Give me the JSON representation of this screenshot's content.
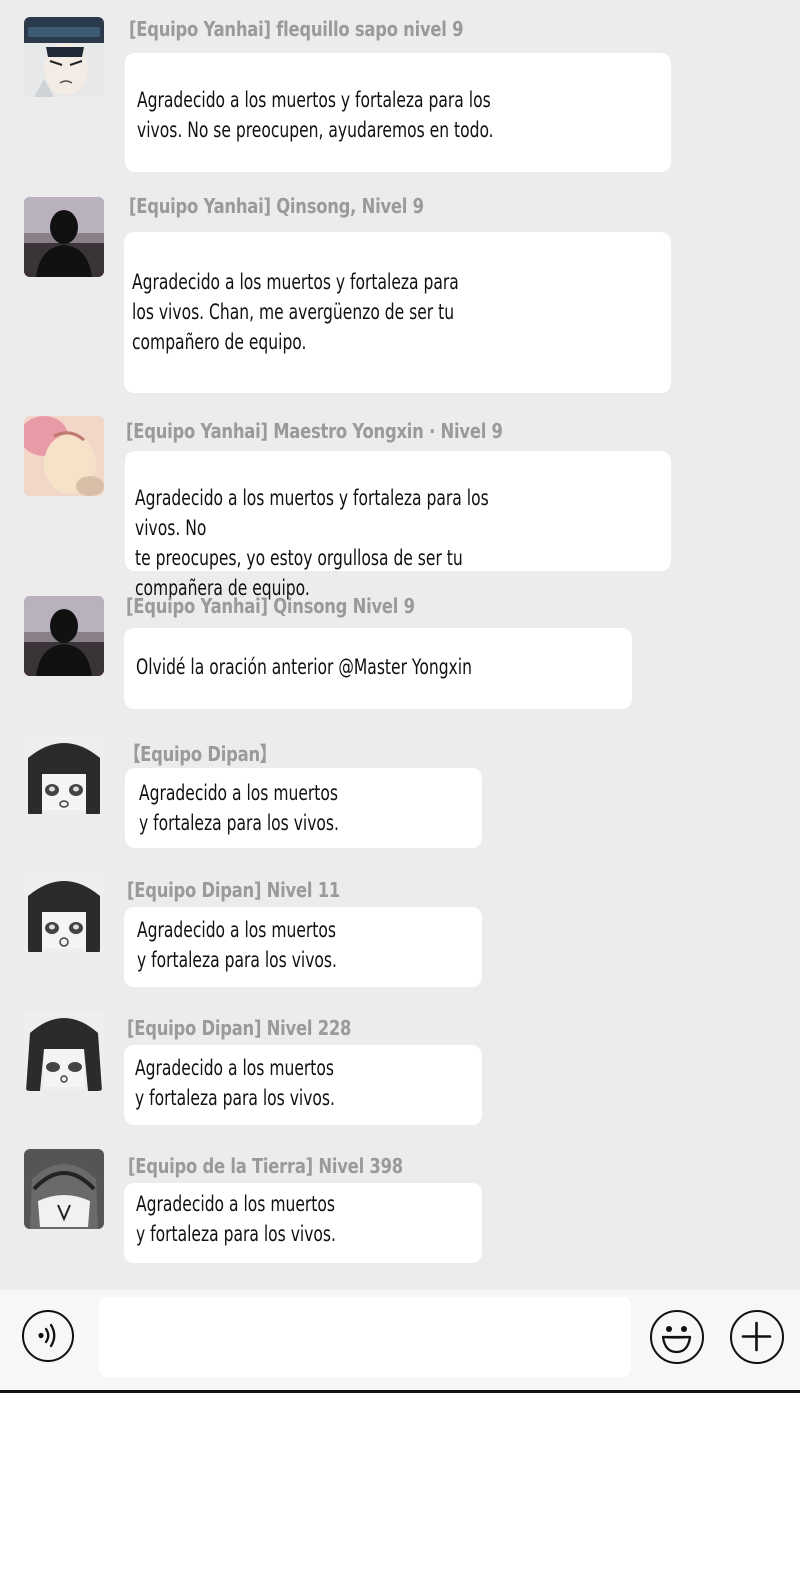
{
  "messages": [
    {
      "sender": "[Equipo Yanhai] flequillo sapo nivel 9",
      "text": "Agradecido a los muertos y fortaleza para los\nvivos. No se preocupen, ayudaremos en todo.",
      "avatar": "avatar-icon"
    },
    {
      "sender": "[Equipo Yanhai] Qinsong, Nivel 9",
      "text": "Agradecido a los muertos y fortaleza para\nlos vivos.  Chan, me avergüenzo de ser tu\ncompañero de equipo.",
      "avatar": "avatar-icon"
    },
    {
      "sender": "[Equipo Yanhai] Maestro Yongxin · Nivel 9",
      "text": "Agradecido a los muertos y fortaleza para los vivos.  No\nte preocupes, yo estoy orgullosa de ser tu compañera de equipo.",
      "avatar": "avatar-icon"
    },
    {
      "sender": "[Equipo Yanhai] Qinsong Nivel 9",
      "text": "Olvidé la oración anterior @Master Yongxin",
      "avatar": "avatar-icon"
    },
    {
      "sender": "【Equipo Dipan】",
      "text": "Agradecido a los muertos\ny fortaleza para los vivos.",
      "avatar": "avatar-icon"
    },
    {
      "sender": "[Equipo Dipan] Nivel 11",
      "text": "Agradecido a los muertos\ny fortaleza para los vivos.",
      "avatar": "avatar-icon"
    },
    {
      "sender": "[Equipo Dipan] Nivel 228",
      "text": "Agradecido a los muertos\ny fortaleza para los vivos.",
      "avatar": "avatar-icon"
    },
    {
      "sender": "[Equipo de la Tierra] Nivel 398",
      "text": "Agradecido a los muertos\ny fortaleza para los vivos.",
      "avatar": "avatar-icon"
    }
  ],
  "input_bar": {
    "voice_icon": "voice-icon",
    "emoji_icon": "emoji-icon",
    "add_icon": "plus-icon",
    "message_value": ""
  }
}
